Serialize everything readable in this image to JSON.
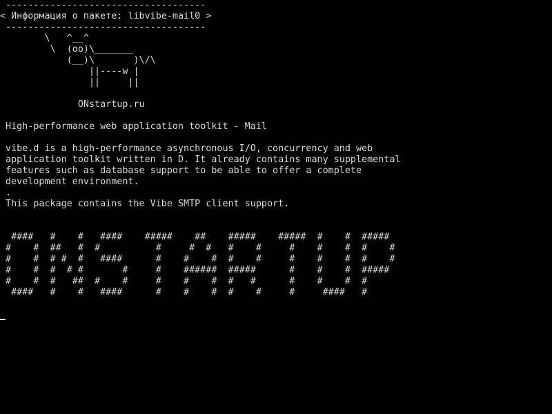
{
  "screen": {
    "lines": [
      " ------------------------------------",
      "< Информация о пакете: libvibe-mail0 >",
      " ------------------------------------",
      "        \\   ^__^",
      "         \\  (oo)\\_______",
      "            (__)\\       )\\/\\",
      "                ||----w |",
      "                ||     ||",
      "",
      "              ONstartup.ru",
      "",
      " High-performance web application toolkit - Mail",
      "",
      " vibe.d is a high-performance asynchronous I/O, concurrency and web",
      " application toolkit written in D. It already contains many supplemental",
      " features such as database support to be able to offer a complete",
      " development environment.",
      " .",
      " This package contains the Vibe SMTP client support.",
      "",
      "",
      "  ####   #    #   ####    #####    ##    #####    #####  #    #  #####",
      " #    #  ##   #  #          #     #  #   #    #     #    #    #  #    #",
      " #    #  # #  #   ####      #    #    #  #    #     #    #    #  #    #",
      " #    #  #  # #       #     #    ######  #####      #    #    #  #####",
      " #    #  #   ##  #    #     #    #    #  #   #      #    #    #  #",
      "  ####   #    #   ####      #    #    #  #    #     #     ####   #"
    ],
    "cursor_symbol": "_"
  }
}
